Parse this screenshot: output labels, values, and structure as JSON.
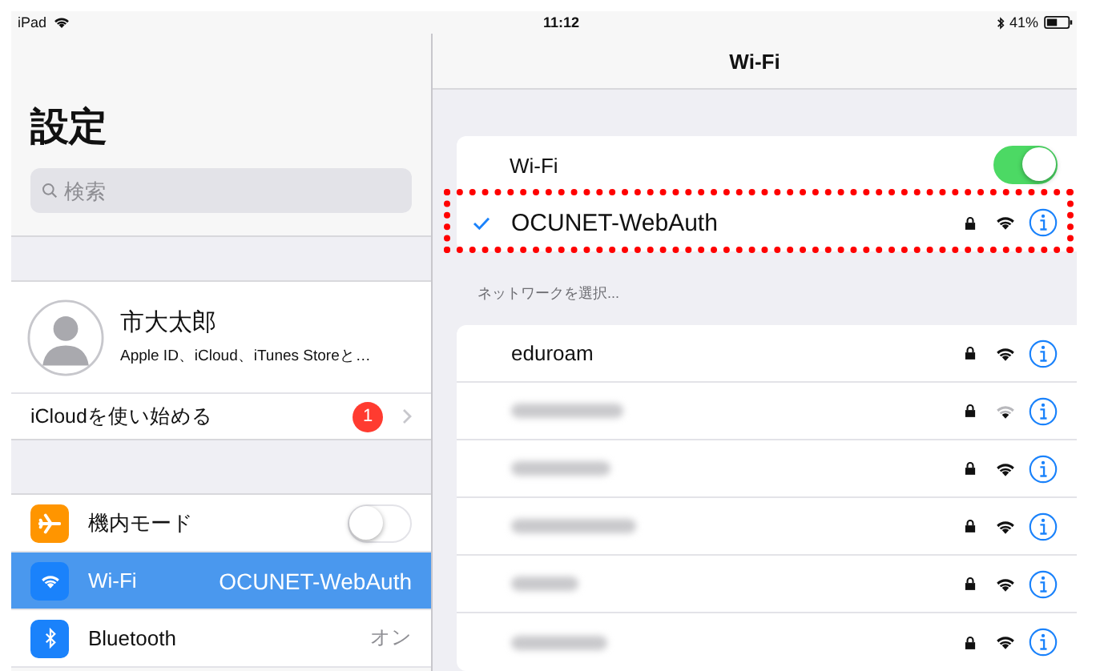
{
  "status_bar": {
    "device": "iPad",
    "time": "11:12",
    "battery": "41%"
  },
  "sidebar": {
    "title": "設定",
    "search": {
      "placeholder": "検索"
    },
    "profile": {
      "name": "市大太郎",
      "subtitle": "Apple ID、iCloud、iTunes Storeと…"
    },
    "icloud": {
      "label": "iCloudを使い始める",
      "badge": "1"
    },
    "items": [
      {
        "kind": "toggle",
        "label": "機内モード",
        "on": false,
        "selected": false,
        "color": "#ff9500"
      },
      {
        "kind": "value",
        "label": "Wi-Fi",
        "value": "OCUNET-WebAuth",
        "selected": true,
        "color": "#1a82fb"
      },
      {
        "kind": "value",
        "label": "Bluetooth",
        "value": "オン",
        "selected": false,
        "color": "#1a82fb"
      }
    ]
  },
  "detail": {
    "title": "Wi-Fi",
    "wifi": {
      "label": "Wi-Fi",
      "on": true
    },
    "current": {
      "name": "OCUNET-WebAuth",
      "checked": true,
      "highlighted": true
    },
    "section_header": "ネットワークを選択...",
    "networks": [
      {
        "kind": "named",
        "name": "eduroam",
        "weak_signal": false
      },
      {
        "kind": "blurred",
        "weak_signal": true
      },
      {
        "kind": "blurred",
        "weak_signal": false
      },
      {
        "kind": "blurred",
        "weak_signal": false
      },
      {
        "kind": "blurred",
        "weak_signal": false
      },
      {
        "kind": "blurred",
        "weak_signal": false
      }
    ]
  }
}
